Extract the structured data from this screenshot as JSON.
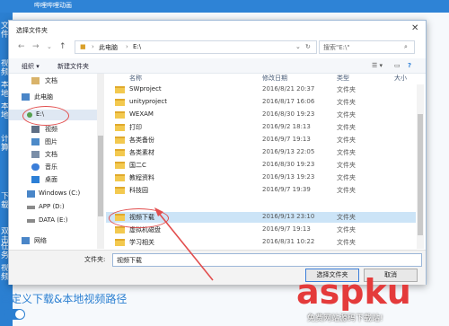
{
  "background_app": {
    "title": "哔哩哔哩动画",
    "left_texts": [
      "文件",
      "视频",
      "本地",
      "本地",
      "计算",
      "下载",
      "双击",
      "任务",
      "视频"
    ],
    "bottom_text": "自定义下载&本地视频路径"
  },
  "dialog": {
    "title": "选择文件夹",
    "close": "✕",
    "address": {
      "parts": [
        "此电脑",
        "E:\\"
      ],
      "separator": "›"
    },
    "search_placeholder": "搜索\"E:\\\"",
    "toolbar": {
      "organize": "组织 ▾",
      "new_folder": "新建文件夹"
    },
    "tree": [
      {
        "label": "文档",
        "icon": "document-icon",
        "color": "#d9b36a"
      },
      {
        "label": "此电脑",
        "icon": "computer-icon",
        "color": "#4a86c8"
      },
      {
        "label": "E:\\",
        "icon": "drive-icon",
        "color": "#55a04f",
        "selected": true
      },
      {
        "label": "视频",
        "icon": "video-icon",
        "color": "#5f6f85"
      },
      {
        "label": "图片",
        "icon": "picture-icon",
        "color": "#4d8ac8"
      },
      {
        "label": "文档",
        "icon": "document-icon",
        "color": "#7a8ea8"
      },
      {
        "label": "音乐",
        "icon": "music-icon",
        "color": "#3b7ed9"
      },
      {
        "label": "桌面",
        "icon": "desktop-icon",
        "color": "#2c7fd6"
      },
      {
        "label": "Windows (C:)",
        "icon": "windows-drive-icon",
        "color": "#4a86c8"
      },
      {
        "label": "APP (D:)",
        "icon": "drive-icon",
        "color": "#8a8a8a"
      },
      {
        "label": "DATA (E:)",
        "icon": "drive-icon",
        "color": "#8a8a8a"
      },
      {
        "label": "网络",
        "icon": "network-icon",
        "color": "#4a86c8"
      }
    ],
    "columns": {
      "name": "名称",
      "date": "修改日期",
      "type": "类型",
      "size": "大小"
    },
    "files": [
      {
        "name": "SWproject",
        "date": "2016/8/21 20:37",
        "type": "文件夹"
      },
      {
        "name": "unityproject",
        "date": "2016/8/17 16:06",
        "type": "文件夹"
      },
      {
        "name": "WEXAM",
        "date": "2016/8/30 19:23",
        "type": "文件夹"
      },
      {
        "name": "打印",
        "date": "2016/9/2 18:13",
        "type": "文件夹"
      },
      {
        "name": "各类备份",
        "date": "2016/9/7 19:13",
        "type": "文件夹"
      },
      {
        "name": "各类素材",
        "date": "2016/9/13 22:05",
        "type": "文件夹"
      },
      {
        "name": "国二C",
        "date": "2016/8/30 19:23",
        "type": "文件夹"
      },
      {
        "name": "教程资料",
        "date": "2016/9/13 19:23",
        "type": "文件夹"
      },
      {
        "name": "科技园",
        "date": "2016/9/7 19:39",
        "type": "文件夹"
      },
      {
        "name": "视频下载",
        "date": "2016/9/13 23:10",
        "type": "文件夹",
        "selected": true
      },
      {
        "name": "虚拟机磁盘",
        "date": "2016/9/7 19:13",
        "type": "文件夹"
      },
      {
        "name": "学习相关",
        "date": "2016/8/31 10:22",
        "type": "文件夹"
      }
    ],
    "filename_label": "文件夹:",
    "filename_value": "视频下载",
    "buttons": {
      "select": "选择文件夹",
      "cancel": "取消"
    }
  },
  "watermark": {
    "main": "aspku",
    "sub": "免费网站源码下载站!"
  },
  "colors": {
    "accent": "#2e83d6",
    "selection": "#cce4f7",
    "annotation": "#e24e4e",
    "folder": "#f3c94f"
  }
}
